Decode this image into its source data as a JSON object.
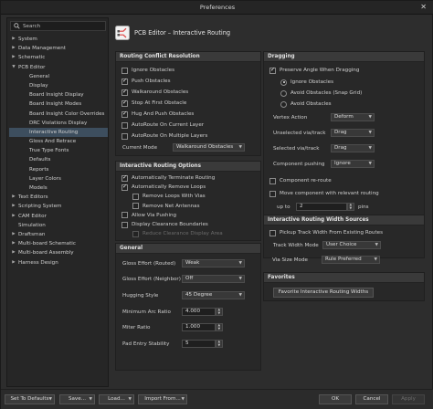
{
  "window": {
    "title": "Preferences",
    "close_glyph": "✕"
  },
  "search": {
    "placeholder": "Search"
  },
  "tree": [
    {
      "label": "System",
      "arrow": "▶",
      "level": 0
    },
    {
      "label": "Data Management",
      "arrow": "▶",
      "level": 0
    },
    {
      "label": "Schematic",
      "arrow": "▶",
      "level": 0
    },
    {
      "label": "PCB Editor",
      "arrow": "▼",
      "level": 0
    },
    {
      "label": "General",
      "arrow": "",
      "level": 1
    },
    {
      "label": "Display",
      "arrow": "",
      "level": 1
    },
    {
      "label": "Board Insight Display",
      "arrow": "",
      "level": 1
    },
    {
      "label": "Board Insight Modes",
      "arrow": "",
      "level": 1
    },
    {
      "label": "Board Insight Color Overrides",
      "arrow": "",
      "level": 1
    },
    {
      "label": "DRC Violations Display",
      "arrow": "",
      "level": 1
    },
    {
      "label": "Interactive Routing",
      "arrow": "",
      "level": 1,
      "selected": true
    },
    {
      "label": "Gloss And Retrace",
      "arrow": "",
      "level": 1
    },
    {
      "label": "True Type Fonts",
      "arrow": "",
      "level": 1
    },
    {
      "label": "Defaults",
      "arrow": "",
      "level": 1
    },
    {
      "label": "Reports",
      "arrow": "",
      "level": 1
    },
    {
      "label": "Layer Colors",
      "arrow": "",
      "level": 1
    },
    {
      "label": "Models",
      "arrow": "",
      "level": 1
    },
    {
      "label": "Text Editors",
      "arrow": "▶",
      "level": 0
    },
    {
      "label": "Scripting System",
      "arrow": "▶",
      "level": 0
    },
    {
      "label": "CAM Editor",
      "arrow": "▶",
      "level": 0
    },
    {
      "label": "Simulation",
      "arrow": "",
      "level": 0
    },
    {
      "label": "Draftsman",
      "arrow": "▶",
      "level": 0
    },
    {
      "label": "Multi-board Schematic",
      "arrow": "▶",
      "level": 0
    },
    {
      "label": "Multi-board Assembly",
      "arrow": "▶",
      "level": 0
    },
    {
      "label": "Harness Design",
      "arrow": "▶",
      "level": 0
    }
  ],
  "page": {
    "title": "PCB Editor – Interactive Routing"
  },
  "conflict": {
    "title": "Routing Conflict Resolution",
    "options": [
      {
        "label": "Ignore Obstacles",
        "on": false
      },
      {
        "label": "Push Obstacles",
        "on": true
      },
      {
        "label": "Walkaround Obstacles",
        "on": true
      },
      {
        "label": "Stop At First Obstacle",
        "on": true
      },
      {
        "label": "Hug And Push Obstacles",
        "on": true
      },
      {
        "label": "AutoRoute On Current Layer",
        "on": false
      },
      {
        "label": "AutoRoute On Multiple Layers",
        "on": false
      }
    ],
    "current_mode_label": "Current Mode",
    "current_mode_value": "Walkaround Obstacles"
  },
  "options": {
    "title": "Interactive Routing Options",
    "items": [
      {
        "label": "Automatically Terminate Routing",
        "on": true,
        "indent": 0,
        "dim": false
      },
      {
        "label": "Automatically Remove Loops",
        "on": true,
        "indent": 0,
        "dim": false
      },
      {
        "label": "Remove Loops With Vias",
        "on": false,
        "indent": 1,
        "dim": false
      },
      {
        "label": "Remove Net Antennas",
        "on": false,
        "indent": 1,
        "dim": false
      },
      {
        "label": "Allow Via Pushing",
        "on": false,
        "indent": 0,
        "dim": false
      },
      {
        "label": "Display Clearance Boundaries",
        "on": false,
        "indent": 0,
        "dim": false
      },
      {
        "label": "Reduce Clearance Display Area",
        "on": false,
        "indent": 1,
        "dim": true
      }
    ]
  },
  "general": {
    "title": "General",
    "gloss_routed_label": "Gloss Effort (Routed)",
    "gloss_routed_value": "Weak",
    "gloss_neighbor_label": "Gloss Effort (Neighbor)",
    "gloss_neighbor_value": "Off",
    "hugging_label": "Hugging Style",
    "hugging_value": "45 Degree",
    "min_arc_label": "Minimum Arc Ratio",
    "min_arc_value": "4.000",
    "miter_label": "Miter Ratio",
    "miter_value": "1.000",
    "pad_entry_label": "Pad Entry Stability",
    "pad_entry_value": "5"
  },
  "dragging": {
    "title": "Dragging",
    "preserve_label": "Preserve Angle When Dragging",
    "preserve_on": true,
    "radios": [
      {
        "label": "Ignore Obstacles",
        "on": true
      },
      {
        "label": "Avoid Obstacles (Snap Grid)",
        "on": false
      },
      {
        "label": "Avoid Obstacles",
        "on": false
      }
    ],
    "vertex_label": "Vertex Action",
    "vertex_value": "Deform",
    "unselected_label": "Unselected via/track",
    "unselected_value": "Drag",
    "selected_label": "Selected via/track",
    "selected_value": "Drag",
    "component_label": "Component pushing",
    "component_value": "Ignore",
    "reroute_label": "Component re-route",
    "reroute_on": false,
    "move_label": "Move component with relevant routing",
    "move_on": false,
    "up_to_label": "up to",
    "up_to_value": "2",
    "pins_label": "pins"
  },
  "width": {
    "title": "Interactive Routing Width Sources",
    "pickup_label": "Pickup Track Width From Existing Routes",
    "pickup_on": false,
    "track_mode_label": "Track Width Mode",
    "track_mode_value": "User Choice",
    "via_mode_label": "Via Size Mode",
    "via_mode_value": "Rule Preferred"
  },
  "favorites": {
    "title": "Favorites",
    "button": "Favorite Interactive Routing Widths"
  },
  "footer": {
    "set_defaults": "Set To Defaults",
    "save": "Save...",
    "load": "Load...",
    "import": "Import From...",
    "ok": "OK",
    "cancel": "Cancel",
    "apply": "Apply"
  }
}
